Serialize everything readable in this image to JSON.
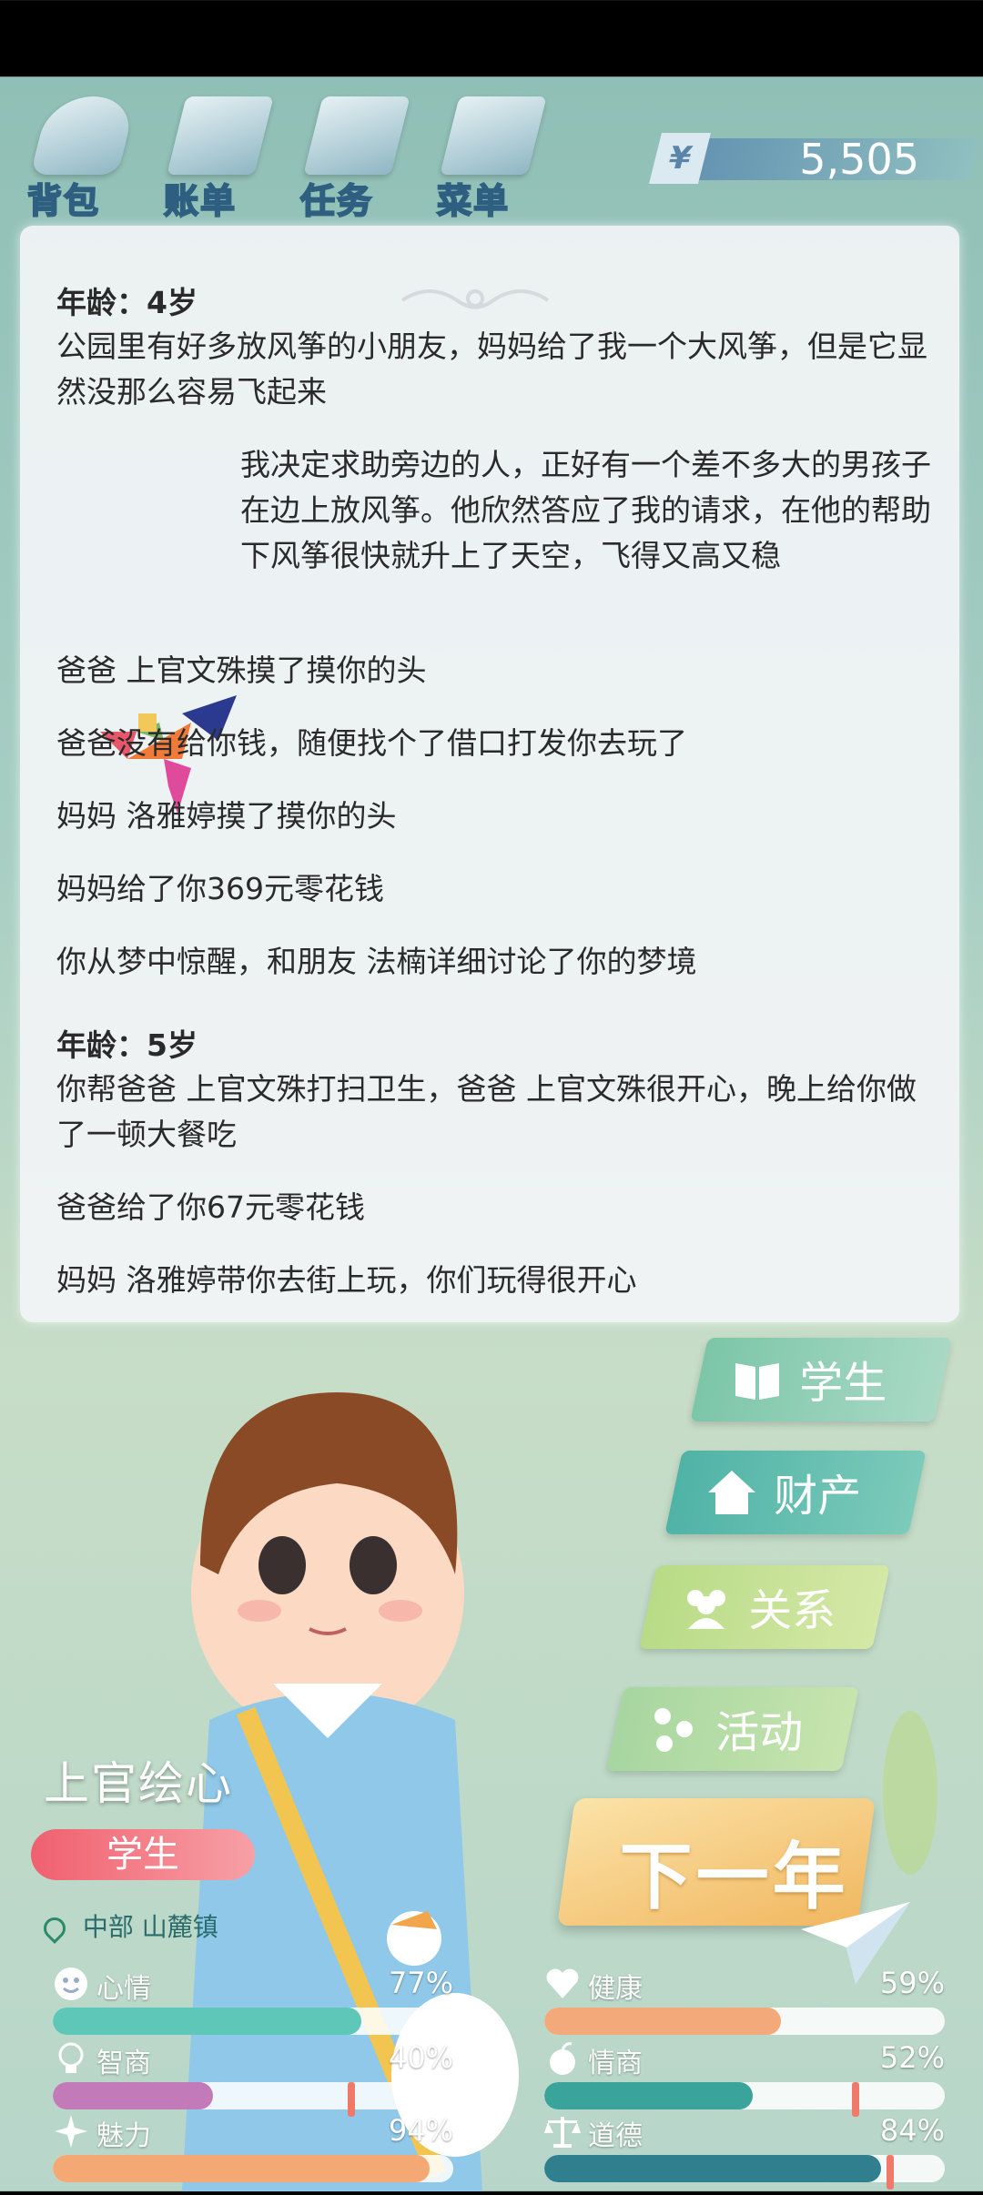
{
  "topbar": {
    "items": [
      {
        "label": "背包",
        "icon": "backpack-icon"
      },
      {
        "label": "账单",
        "icon": "bill-icon"
      },
      {
        "label": "任务",
        "icon": "task-icon"
      },
      {
        "label": "菜单",
        "icon": "menu-icon"
      }
    ],
    "currency_symbol": "¥",
    "money": "5,505"
  },
  "log": {
    "age4_label": "年龄：4岁",
    "age4_line1": "公园里有好多放风筝的小朋友，妈妈给了我一个大风筝，但是它显然没那么容易飞起来",
    "age4_kite": "我决定求助旁边的人，正好有一个差不多大的男孩子在边上放风筝。他欣然答应了我的请求，在他的帮助下风筝很快就升上了天空，飞得又高又稳",
    "age4_e1": "爸爸 上官文殊摸了摸你的头",
    "age4_e2": "爸爸没有给你钱，随便找个了借口打发你去玩了",
    "age4_e3": "妈妈 洛雅婷摸了摸你的头",
    "age4_e4": "妈妈给了你369元零花钱",
    "age4_e5": "你从梦中惊醒，和朋友 法楠详细讨论了你的梦境",
    "age5_label": "年龄：5岁",
    "age5_e1": "你帮爸爸 上官文殊打扫卫生，爸爸 上官文殊很开心，晚上给你做了一顿大餐吃",
    "age5_e2": "爸爸给了你67元零花钱",
    "age5_e3": "妈妈 洛雅婷带你去街上玩，你们玩得很开心"
  },
  "character": {
    "name": "上官绘心",
    "occupation": "学生",
    "location": "中部 山麓镇"
  },
  "side_buttons": [
    {
      "label": "学生",
      "icon": "book-icon"
    },
    {
      "label": "财产",
      "icon": "house-icon"
    },
    {
      "label": "关系",
      "icon": "people-icon"
    },
    {
      "label": "活动",
      "icon": "activity-icon"
    }
  ],
  "next_year_label": "下一年",
  "stats": [
    {
      "name": "心情",
      "value": "77%",
      "fraction": 0.77,
      "color": "#5ec7b8",
      "icon": "smile-icon"
    },
    {
      "name": "健康",
      "value": "59%",
      "fraction": 0.59,
      "color": "#f4a97a",
      "icon": "heart-icon"
    },
    {
      "name": "智商",
      "value": "40%",
      "fraction": 0.4,
      "color": "#c27ab8",
      "icon": "bulb-icon"
    },
    {
      "name": "情商",
      "value": "52%",
      "fraction": 0.52,
      "color": "#3aa39a",
      "icon": "apple-icon"
    },
    {
      "name": "魅力",
      "value": "94%",
      "fraction": 0.94,
      "color": "#f4a873",
      "icon": "sparkle-icon"
    },
    {
      "name": "道德",
      "value": "84%",
      "fraction": 0.84,
      "color": "#2f7f8f",
      "icon": "scale-icon"
    }
  ]
}
